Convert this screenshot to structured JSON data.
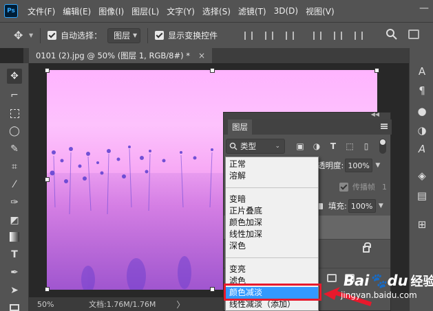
{
  "app": {
    "logo": "Ps"
  },
  "menu": [
    "文件(F)",
    "编辑(E)",
    "图像(I)",
    "图层(L)",
    "文字(Y)",
    "选择(S)",
    "滤镜(T)",
    "3D(D)",
    "视图(V)"
  ],
  "options": {
    "auto_select_label": "自动选择：",
    "auto_select_value": "图层",
    "show_transform_label": "显示变换控件"
  },
  "document_tab": {
    "title": "0101 (2).jpg @ 50% (图层 1, RGB/8#) *",
    "close": "×"
  },
  "status": {
    "zoom": "50%",
    "doc_info": "文档:1.76M/1.76M",
    "arrow": "〉"
  },
  "layers_panel": {
    "title": "图层",
    "kind_filter": "类型",
    "opacity_label": "透明度:",
    "opacity_value": "100%",
    "propagate_label": "传播帧",
    "propagate_value": "1",
    "fill_label": "填充:",
    "fill_value": "100%"
  },
  "blend_modes": {
    "group1": [
      "正常",
      "溶解"
    ],
    "group2": [
      "变暗",
      "正片叠底",
      "颜色加深",
      "线性加深",
      "深色"
    ],
    "group3": [
      "变亮",
      "滤色",
      "颜色减淡",
      "线性减淡（添加）"
    ],
    "selected": "颜色减淡"
  },
  "watermark": {
    "brand": "Bai",
    "brand2": "du",
    "suffix": "经验",
    "url": "jingyan.baidu.com"
  },
  "colors": {
    "highlight": "#e8192c",
    "selection": "#3399ff",
    "image_tint": "#f7aaf5"
  },
  "icons": {
    "tools": [
      "move-icon",
      "artboard-icon",
      "marquee-icon",
      "lasso-icon",
      "quick-select-icon",
      "crop-icon",
      "eyedropper-icon",
      "brush-icon",
      "eraser-icon",
      "gradient-icon",
      "type-icon",
      "pen-icon",
      "path-select-icon",
      "rectangle-icon"
    ],
    "right_panel": [
      "character-icon",
      "paragraph-icon",
      "color-icon",
      "adjustments-icon",
      "glyphs-icon",
      "3d-icon",
      "properties-icon",
      "grid-icon"
    ]
  }
}
